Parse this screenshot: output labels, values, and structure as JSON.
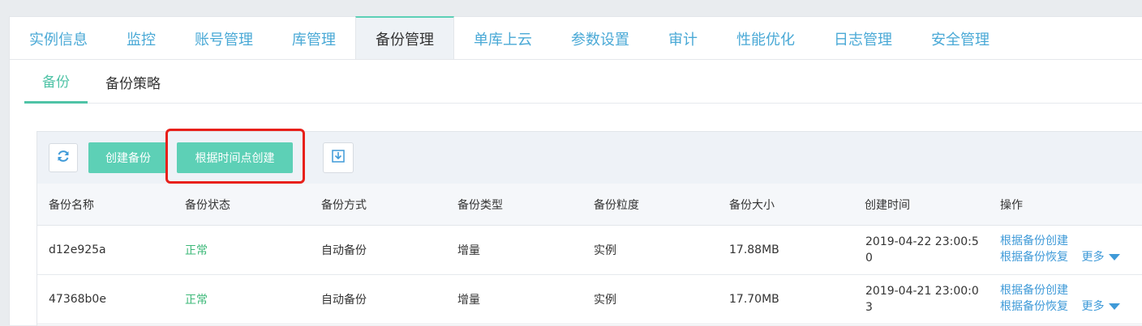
{
  "top_tabs": [
    {
      "label": "实例信息"
    },
    {
      "label": "监控"
    },
    {
      "label": "账号管理"
    },
    {
      "label": "库管理"
    },
    {
      "label": "备份管理"
    },
    {
      "label": "单库上云"
    },
    {
      "label": "参数设置"
    },
    {
      "label": "审计"
    },
    {
      "label": "性能优化"
    },
    {
      "label": "日志管理"
    },
    {
      "label": "安全管理"
    }
  ],
  "active_top_tab": "备份管理",
  "sub_tabs": [
    {
      "label": "备份"
    },
    {
      "label": "备份策略"
    }
  ],
  "active_sub_tab": "备份",
  "toolbar": {
    "refresh_icon": "refresh-icon",
    "create_backup_label": "创建备份",
    "create_by_time_label": "根据时间点创建",
    "download_icon": "download-icon"
  },
  "table": {
    "columns": [
      "备份名称",
      "备份状态",
      "备份方式",
      "备份类型",
      "备份粒度",
      "备份大小",
      "创建时间",
      "操作"
    ],
    "rows": [
      {
        "name": "d12e925a",
        "status": "正常",
        "method": "自动备份",
        "type": "增量",
        "granularity": "实例",
        "size": "17.88MB",
        "created": "2019-04-22 23:00:50",
        "op_create": "根据备份创建",
        "op_restore": "根据备份恢复",
        "op_more": "更多"
      },
      {
        "name": "47368b0e",
        "status": "正常",
        "method": "自动备份",
        "type": "增量",
        "granularity": "实例",
        "size": "17.70MB",
        "created": "2019-04-21 23:00:03",
        "op_create": "根据备份创建",
        "op_restore": "根据备份恢复",
        "op_more": "更多"
      }
    ]
  },
  "colors": {
    "accent_green": "#5dd0b6",
    "link_blue": "#3f9ad8",
    "status_ok": "#3cb878",
    "highlight_red": "#e8201a"
  }
}
